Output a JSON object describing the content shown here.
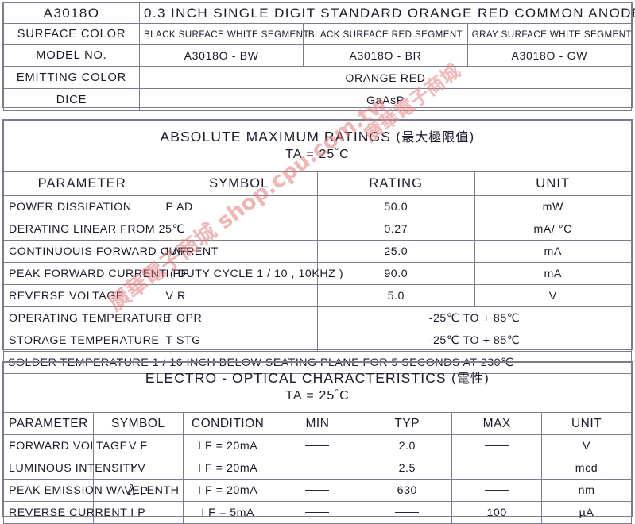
{
  "watermark": {
    "line_main": "廣華電子商城 shop.cpu.com.tw",
    "line_secondary": "廣華電子商城",
    "color": "#e87878"
  },
  "spec_table": {
    "part_number": "A3018O",
    "description": "0.3 INCH SINGLE DIGIT STANDARD ORANGE RED COMMON ANODE",
    "rows": [
      {
        "label": "SURFACE COLOR",
        "values": [
          "BLACK SURFACE WHITE SEGMENT",
          "BLACK SURFACE RED SEGMENT",
          "GRAY SURFACE WHITE SEGMENT"
        ]
      },
      {
        "label": "MODEL NO.",
        "values": [
          "A3018O - BW",
          "A3018O - BR",
          "A3018O - GW"
        ]
      },
      {
        "label": "EMITTING COLOR",
        "span_value": "ORANGE RED"
      },
      {
        "label": "DICE",
        "span_value": "GaAsP"
      }
    ]
  },
  "absolute_maximum_ratings": {
    "title": "ABSOLUTE MAXIMUM RATINGS (最大極限值)",
    "title_en": "ABSOLUTE MAXIMUM RATINGS",
    "title_cjk": "(最大極限值)",
    "subtitle_prefix": "TA = 25",
    "subtitle_suffix": "C",
    "columns": [
      "PARAMETER",
      "SYMBOL",
      "RATING",
      "UNIT"
    ],
    "rows": [
      {
        "parameter": "POWER DISSIPATION",
        "symbol": "P AD",
        "rating": "50.0",
        "unit": "mW"
      },
      {
        "parameter": "DERATING LINEAR FROM 25℃",
        "symbol": "",
        "rating": "0.27",
        "unit": "mA/ °C"
      },
      {
        "parameter": "CONTINUOUIS FORWARD CURRENT",
        "symbol": "I AF",
        "rating": "25.0",
        "unit": "mA"
      },
      {
        "parameter": "PEAK FORWARD CURRENT ( DUTY CYCLE 1 / 10 , 10KHZ )",
        "symbol": "I PF",
        "rating": "90.0",
        "unit": "mA"
      },
      {
        "parameter": "REVERSE VOLTAGE",
        "symbol": "V R",
        "rating": "5.0",
        "unit": "V"
      },
      {
        "parameter": "OPERATING TEMPERATURE",
        "symbol": "T OPR",
        "rating_span": "-25℃  TO  + 85℃"
      },
      {
        "parameter": "STORAGE TEMPERATURE",
        "symbol": "T STG",
        "rating_span": "-25℃  TO  + 85℃"
      }
    ],
    "footnote": "SOLDER TEMPERATURE 1 / 16 INCH BELOW SEATING PLANE FOR 5 SECONDS AT 230℃"
  },
  "electro_optical_characteristics": {
    "title": "ELECTRO - OPTICAL CHARACTERISTICS (電性)",
    "title_en": "ELECTRO - OPTICAL CHARACTERISTICS",
    "title_cjk": "(電性)",
    "subtitle_prefix": "TA = 25",
    "subtitle_suffix": "C",
    "columns": [
      "PARAMETER",
      "SYMBOL",
      "CONDITION",
      "MIN",
      "TYP",
      "MAX",
      "UNIT"
    ],
    "rows": [
      {
        "parameter": "FORWARD VOLTAGE",
        "symbol": "V F",
        "symbol_is_lambda": false,
        "condition": "I F = 20mA",
        "min": "—",
        "typ": "2.0",
        "max": "—",
        "unit": "V"
      },
      {
        "parameter": "LUMINOUS INTENSITY",
        "symbol": "I V",
        "symbol_is_lambda": false,
        "condition": "I F = 20mA",
        "min": "—",
        "typ": "2.5",
        "max": "—",
        "unit": "mcd"
      },
      {
        "parameter": "PEAK EMISSION WAVELENTH",
        "symbol": "P",
        "symbol_is_lambda": true,
        "condition": "I F = 20mA",
        "min": "—",
        "typ": "630",
        "max": "—",
        "unit": "nm"
      },
      {
        "parameter": "REVERSE CURRENT",
        "symbol": "I P",
        "symbol_is_lambda": false,
        "condition": "I F = 5mA",
        "min": "—",
        "typ": "—",
        "max": "100",
        "unit": "µA"
      }
    ]
  }
}
